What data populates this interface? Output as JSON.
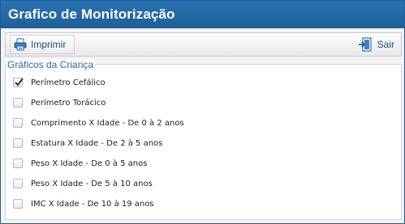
{
  "window": {
    "title": "Grafico de Monitorização"
  },
  "toolbar": {
    "print_label": "Imprimir",
    "exit_label": "Sair"
  },
  "group": {
    "legend": "Gráficos da Criança",
    "items": [
      {
        "label": "Perímetro Cefálico",
        "checked": true
      },
      {
        "label": "Perímetro Torácico",
        "checked": false
      },
      {
        "label": "Comprimento X Idade - De 0 à 2 anos",
        "checked": false
      },
      {
        "label": "Estatura X Idade - De 2 à 5 anos",
        "checked": false
      },
      {
        "label": "Peso X Idade - De 0 à 5 anos",
        "checked": false
      },
      {
        "label": "Peso X Idade - De 5 à 10 anos",
        "checked": false
      },
      {
        "label": "IMC X Idade - De 10 à 19 anos",
        "checked": false
      }
    ]
  },
  "colors": {
    "titlebar": "#1f66a6",
    "accent": "#1d4f86",
    "legend": "#2a6aa8"
  },
  "icons": {
    "print": "printer-icon",
    "exit": "exit-door-icon",
    "check": "checkmark-icon"
  }
}
